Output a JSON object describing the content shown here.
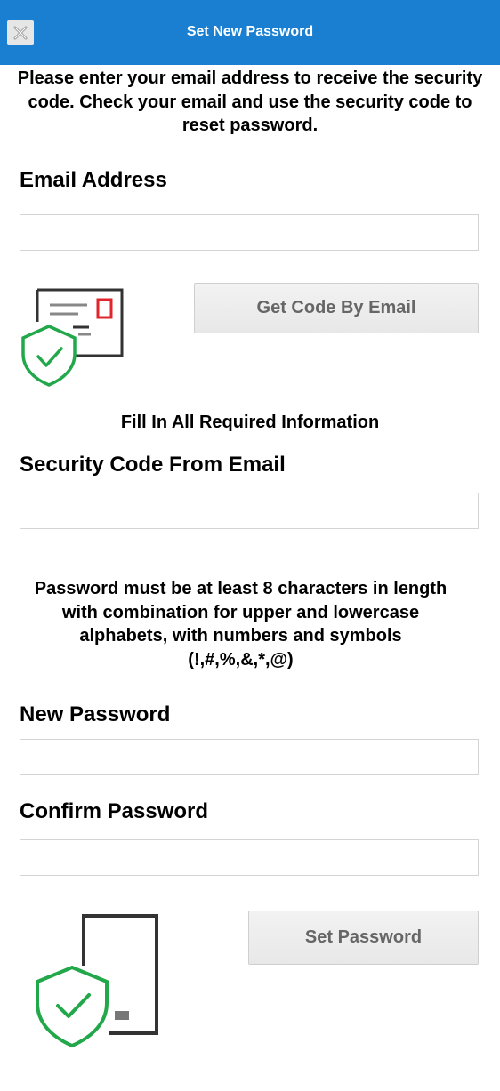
{
  "header": {
    "title": "Set New Password",
    "close_icon": "close-icon"
  },
  "intro": {
    "line1": "Please enter your email address to receive the security",
    "line2": "code. Check your email and use the security code to",
    "line3": "reset password."
  },
  "email": {
    "label": "Email Address",
    "value": "",
    "placeholder": ""
  },
  "get_code_button": "Get Code By Email",
  "required_notice": "Fill In All Required Information",
  "security_code": {
    "label": "Security Code From Email",
    "value": "",
    "placeholder": ""
  },
  "password_rules": {
    "line1": "Password must be at least 8 characters in length",
    "line2": "with combination for upper and lowercase",
    "line3": "alphabets, with numbers and symbols",
    "line4": "(!,#,%,&,*,@)"
  },
  "new_password": {
    "label": "New Password",
    "value": "",
    "placeholder": ""
  },
  "confirm_password": {
    "label": "Confirm Password",
    "value": "",
    "placeholder": ""
  },
  "set_password_button": "Set Password",
  "colors": {
    "header": "#1a7fd0",
    "shield": "#22a84a",
    "accent_red": "#e0262b",
    "outline": "#333333"
  },
  "icons": {
    "email_illustration": "email-shield-icon",
    "phone_illustration": "phone-shield-icon"
  }
}
